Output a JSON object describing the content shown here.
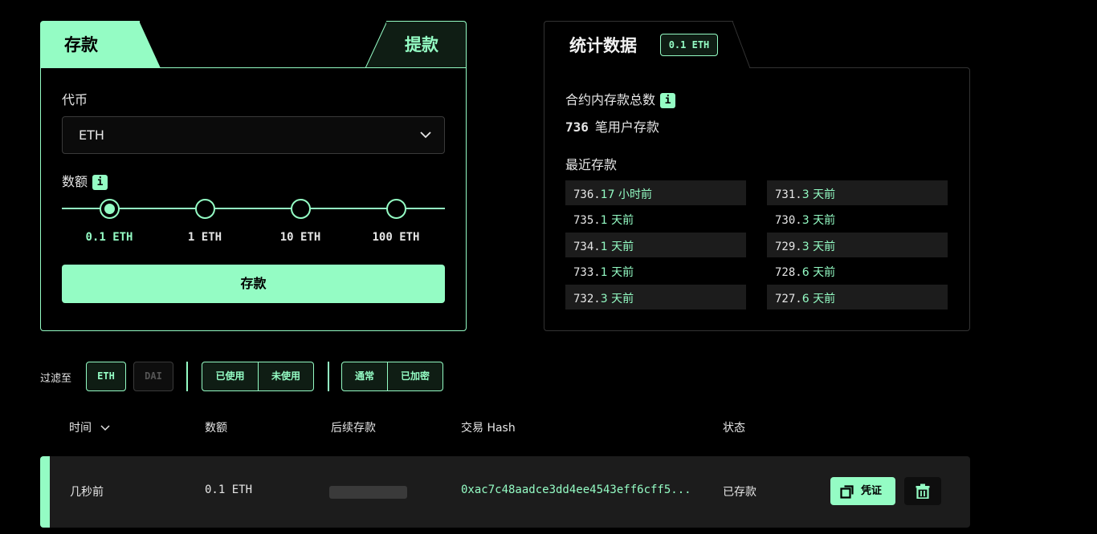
{
  "deposit_panel": {
    "tab_deposit": "存款",
    "tab_withdraw": "提款",
    "token_label": "代币",
    "token_value": "ETH",
    "amount_label": "数额",
    "info_icon": "i",
    "amount_options": [
      "0.1 ETH",
      "1 ETH",
      "10 ETH",
      "100 ETH"
    ],
    "selected_amount": "0.1 ETH",
    "deposit_button": "存款"
  },
  "stats_panel": {
    "title": "统计数据",
    "amount_badge": "0.1 ETH",
    "total_label": "合约内存款总数",
    "info_icon": "i",
    "count_value": "736",
    "count_suffix": "笔用户存款",
    "recent_label": "最近存款",
    "recent_left": [
      {
        "index": "736.",
        "ago": "17 小时前"
      },
      {
        "index": "735.",
        "ago": "1 天前"
      },
      {
        "index": "734.",
        "ago": "1 天前"
      },
      {
        "index": "733.",
        "ago": "1 天前"
      },
      {
        "index": "732.",
        "ago": "3 天前"
      }
    ],
    "recent_right": [
      {
        "index": "731.",
        "ago": "3 天前"
      },
      {
        "index": "730.",
        "ago": "3 天前"
      },
      {
        "index": "729.",
        "ago": "3 天前"
      },
      {
        "index": "728.",
        "ago": "6 天前"
      },
      {
        "index": "727.",
        "ago": "6 天前"
      }
    ]
  },
  "filters": {
    "label": "过滤至",
    "token_eth": "ETH",
    "token_dai": "DAI",
    "used": "已使用",
    "unused": "未使用",
    "normal": "通常",
    "encrypted": "已加密"
  },
  "table": {
    "headers": {
      "time": "时间",
      "amount": "数额",
      "subsequent": "后续存款",
      "tx_hash": "交易 Hash",
      "status": "状态"
    },
    "rows": [
      {
        "time": "几秒前",
        "amount": "0.1 ETH",
        "tx_hash": "0xac7c48aadce3dd4ee4543eff6cff5...",
        "status": "已存款",
        "proof_button": "凭证"
      }
    ]
  },
  "colors": {
    "accent": "#94fcc4",
    "background": "#000000",
    "row_bg": "#1c1c1c"
  },
  "icons": {
    "token_dropdown": "chevron-down-icon",
    "sort": "chevron-down-icon",
    "proof": "copy-icon",
    "delete": "trash-icon"
  }
}
